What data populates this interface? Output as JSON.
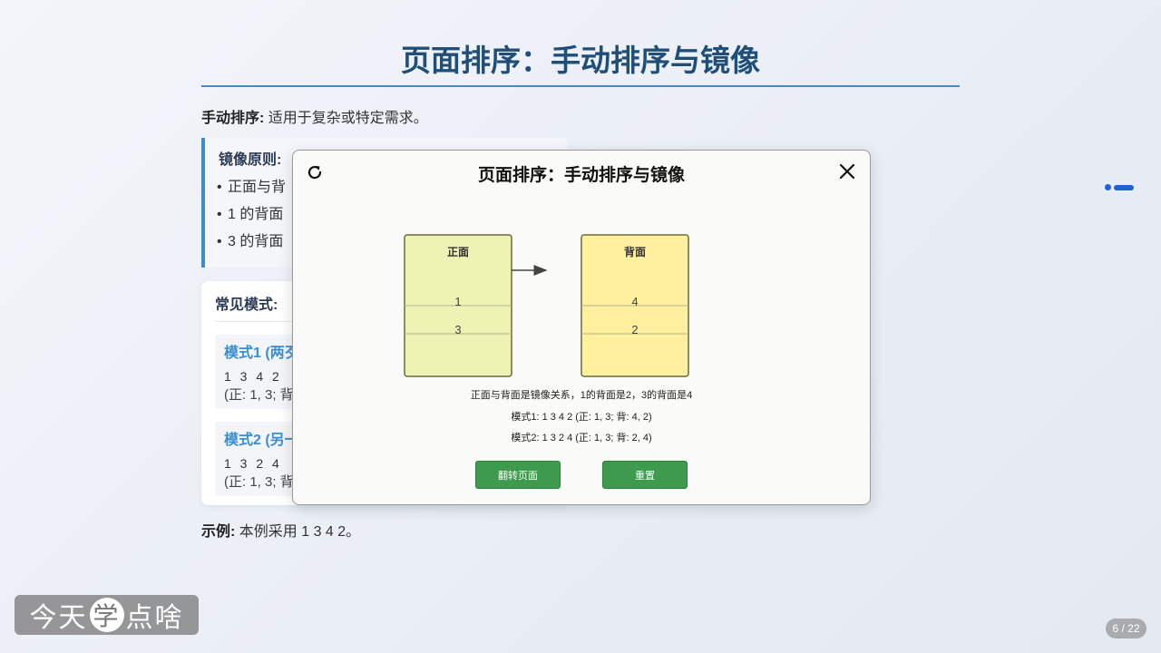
{
  "slide": {
    "title": "页面排序：手动排序与镜像",
    "intro_label": "手动排序:",
    "intro_text": " 适用于复杂或特定需求。",
    "mirror": {
      "title": "镜像原则:",
      "items": [
        "正面与背",
        "1 的背面",
        "3 的背面"
      ]
    },
    "modes": {
      "title": "常见模式:",
      "items": [
        {
          "title": "模式1 (两歹",
          "seq": "1 3 4 2",
          "desc": "(正: 1, 3; 背"
        },
        {
          "title": "模式2 (另一",
          "seq": "1 3 2 4",
          "desc": "(正: 1, 3; 背"
        }
      ]
    },
    "example_label": "示例:",
    "example_text": " 本例采用 1 3 4 2。"
  },
  "modal": {
    "title": "页面排序：手动排序与镜像",
    "front_label": "正面",
    "back_label": "背面",
    "front_pages": [
      "1",
      "3"
    ],
    "back_pages": [
      "4",
      "2"
    ],
    "caption_main": "正面与背面是镜像关系，1的背面是2，3的背面是4",
    "caption_mode1": "模式1: 1 3 4 2 (正: 1, 3; 背: 4, 2)",
    "caption_mode2": "模式2: 1 3 2 4 (正: 1, 3; 背: 2, 4)",
    "flip_button": "翻转页面",
    "reset_button": "重置",
    "icons": {
      "refresh": "refresh-icon",
      "close": "close-icon"
    },
    "colors": {
      "front_fill": "#eef3b4",
      "back_fill": "#fff0a0",
      "button": "#3e9a4d"
    }
  },
  "watermark": {
    "part1": "今天",
    "circle": "学",
    "part2": "点啥"
  },
  "page_counter": "6 / 22"
}
